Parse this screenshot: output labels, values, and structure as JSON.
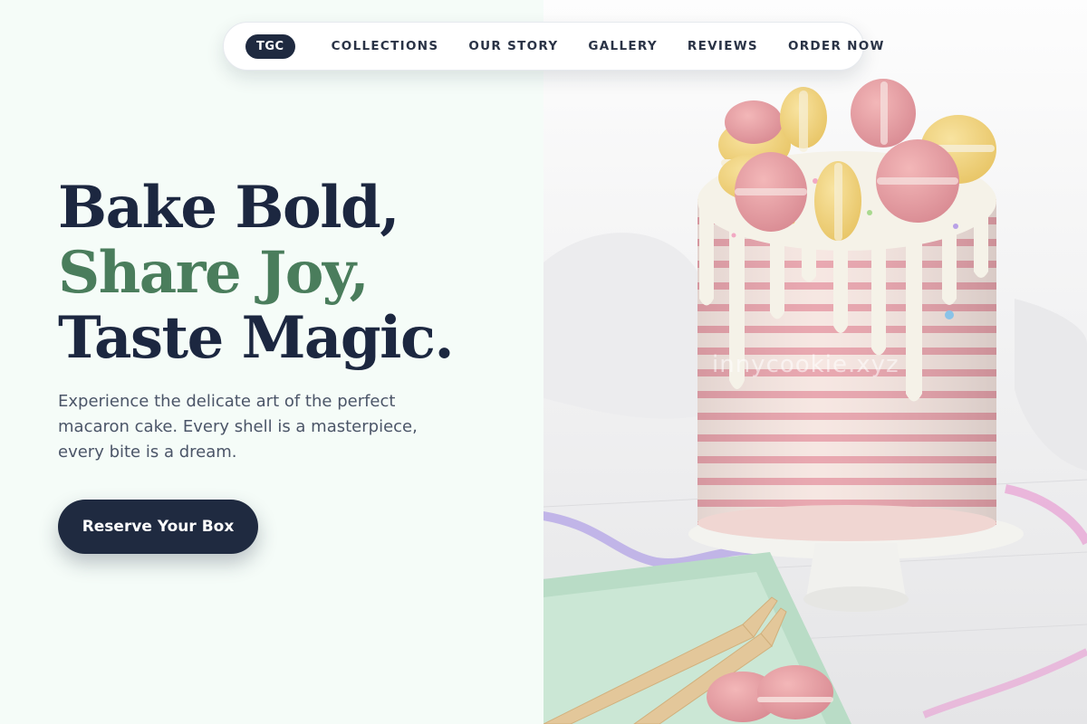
{
  "nav": {
    "logo": "TGC",
    "links": [
      "COLLECTIONS",
      "OUR STORY",
      "GALLERY",
      "REVIEWS",
      "ORDER NOW"
    ]
  },
  "hero": {
    "headline_line1": "Bake Bold,",
    "headline_line2": "Share Joy,",
    "headline_line3": "Taste Magic.",
    "subtext": "Experience the delicate art of the perfect macaron cake. Every shell is a masterpiece, every bite is a dream.",
    "cta_label": "Reserve Your Box"
  },
  "image": {
    "watermark": "innycookie.xyz",
    "subject": "cake-with-macarons"
  },
  "colors": {
    "navy": "#1f2a40",
    "green_accent": "#4a7d5c",
    "left_bg": "#f5fcf8",
    "macaron_pink": "#e89aa0",
    "macaron_yellow": "#f1d27c",
    "plate_green": "#b9dcc6"
  }
}
